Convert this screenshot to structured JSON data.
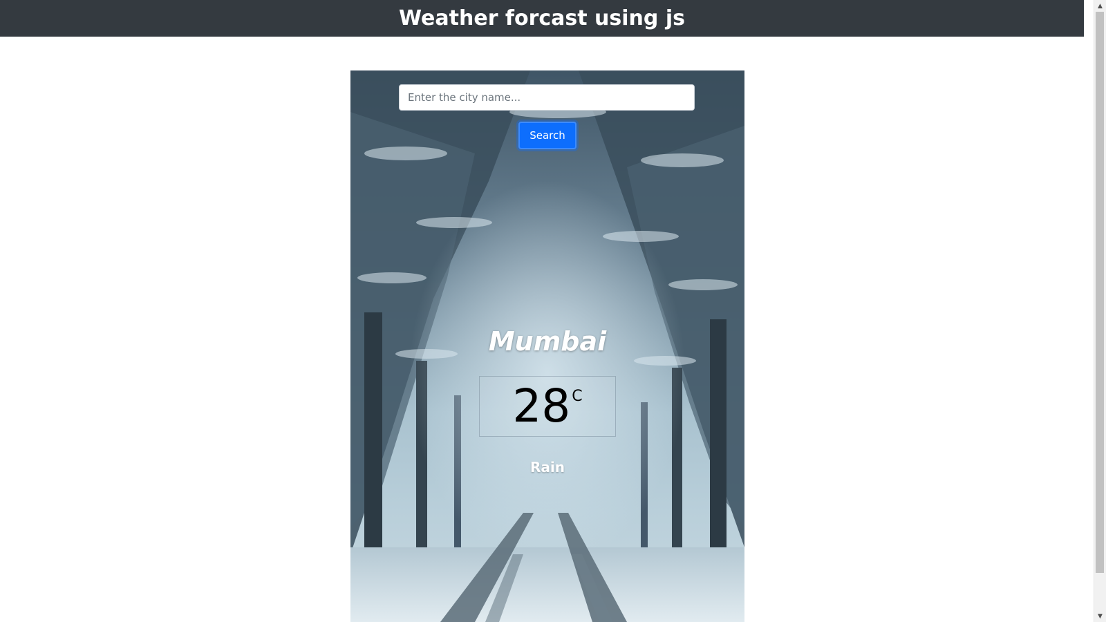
{
  "header": {
    "title": "Weather forcast using js"
  },
  "search": {
    "placeholder": "Enter the city name...",
    "value": "",
    "button_label": "Search"
  },
  "weather": {
    "city": "Mumbai",
    "temperature": "28",
    "unit": "C",
    "condition": "Rain"
  },
  "scrollbar": {
    "up_arrow": "▲",
    "down_arrow": "▼"
  },
  "colors": {
    "navbar": "#343a40",
    "button": "#0d6efd",
    "text_light": "#ffffff"
  }
}
